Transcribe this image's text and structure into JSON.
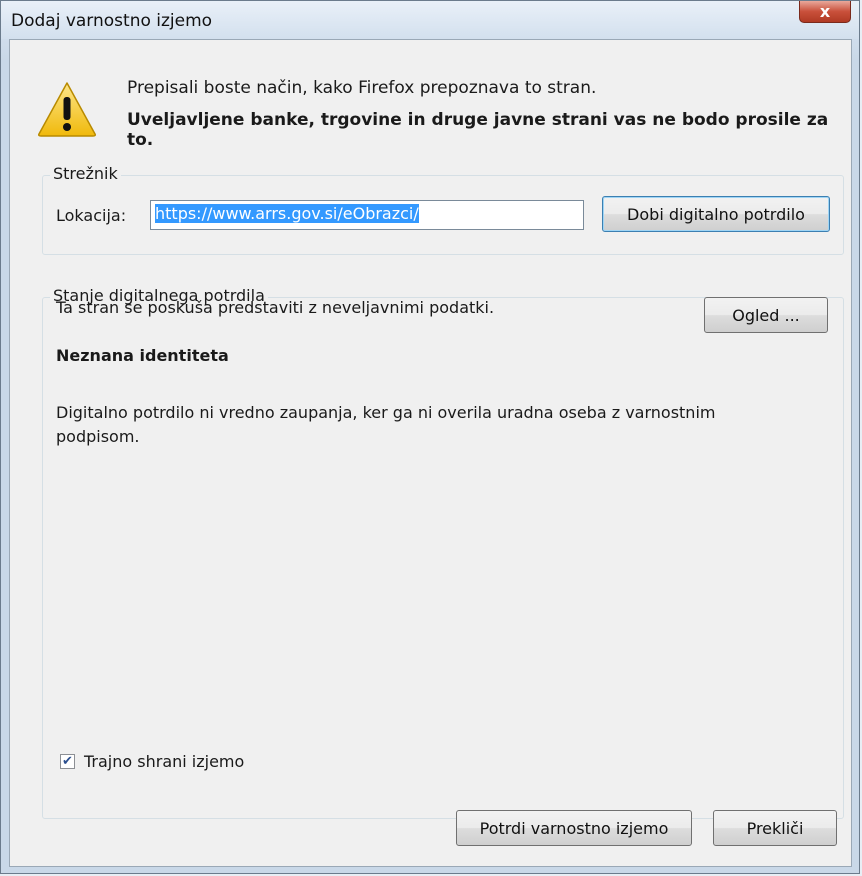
{
  "window": {
    "title": "Dodaj varnostno izjemo",
    "close_label": "x"
  },
  "message": {
    "line1": "Prepisali boste način, kako Firefox prepoznava to stran.",
    "line2": "Uveljavljene banke, trgovine in druge javne strani vas ne bodo prosile za to."
  },
  "server": {
    "group_label": "Strežnik",
    "location_label": "Lokacija:",
    "location_value": "https://www.arrs.gov.si/eObrazci/",
    "get_cert_label": "Dobi digitalno potrdilo"
  },
  "certificate_status": {
    "group_label": "Stanje digitalnega potrdila",
    "status_text": "Ta stran se poskuša predstaviti z neveljavnimi podatki.",
    "view_label": "Ogled ...",
    "identity_title": "Neznana identiteta",
    "description": "Digitalno potrdilo ni vredno zaupanja, ker ga ni overila uradna oseba z varnostnim podpisom."
  },
  "permanent": {
    "label": "Trajno shrani izjemo",
    "checked": true
  },
  "buttons": {
    "confirm_label": "Potrdi varnostno izjemo",
    "cancel_label": "Prekliči"
  },
  "colors": {
    "selection": "#3399ff",
    "close_button": "#c9503b",
    "warning_icon": "#f5c518"
  }
}
